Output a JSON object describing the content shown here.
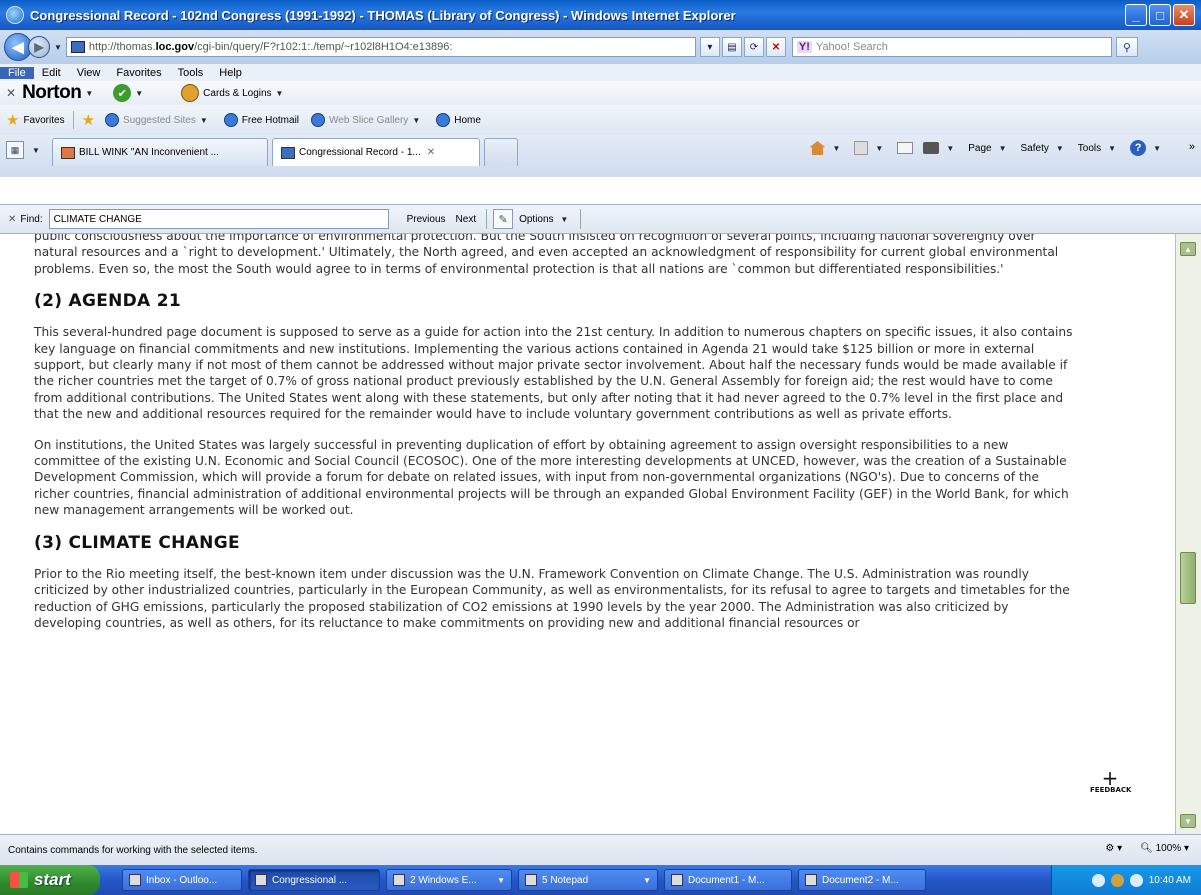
{
  "window": {
    "title": "Congressional Record - 102nd Congress (1991-1992) - THOMAS (Library of Congress) - Windows Internet Explorer"
  },
  "address_bar": {
    "url_prefix": "http://thomas.",
    "url_bold": "loc.gov",
    "url_rest": "/cgi-bin/query/F?r102:1:./temp/~r102l8H1O4:e13896:",
    "search_placeholder": "Yahoo! Search"
  },
  "menu": {
    "items": [
      "File",
      "Edit",
      "View",
      "Favorites",
      "Tools",
      "Help"
    ]
  },
  "norton": {
    "brand": "Norton",
    "cards_label": "Cards & Logins"
  },
  "favorites_bar": {
    "favorites_label": "Favorites",
    "items": [
      "Suggested Sites",
      "Free Hotmail",
      "Web Slice Gallery",
      "Home"
    ]
  },
  "tabs": [
    {
      "label": "BILL WINK \"AN Inconvenient ..."
    },
    {
      "label": "Congressional Record - 1..."
    }
  ],
  "command_bar": {
    "page": "Page",
    "safety": "Safety",
    "tools": "Tools"
  },
  "find_bar": {
    "label": "Find:",
    "value": "CLIMATE CHANGE",
    "previous": "Previous",
    "next": "Next",
    "options": "Options"
  },
  "content": {
    "para0": "public consciousness about the importance of environmental protection. But the South insisted on recognition of several points, including national sovereignty over natural resources and a `right to development.' Ultimately, the North agreed, and even accepted an acknowledgment of responsibility for current global environmental problems. Even so, the most the South would agree to in terms of environmental protection is that all nations are `common but differentiated responsibilities.'",
    "heading1": "(2) AGENDA 21",
    "para1": "This several-hundred page document is supposed to serve as a guide for action into the 21st century. In addition to numerous chapters on specific issues, it also contains key language on financial commitments and new institutions. Implementing the various actions contained in Agenda 21 would take $125 billion or more in external support, but clearly many if not most of them cannot be addressed without major private sector involvement. About half the necessary funds would be made available if the richer countries met the target of 0.7% of gross national product previously established by the U.N. General Assembly for foreign aid; the rest would have to come from additional contributions. The United States went along with these statements, but only after noting that it had never agreed to the 0.7% level in the first place and that the new and additional resources required for the remainder would have to include voluntary government contributions as well as private efforts.",
    "para2": "On institutions, the United States was largely successful in preventing duplication of effort by obtaining agreement to assign oversight responsibilities to a new committee of the existing U.N. Economic and Social Council (ECOSOC). One of the more interesting developments at UNCED, however, was the creation of a Sustainable Development Commission, which will provide a forum for debate on related issues, with input from non-governmental organizations (NGO's). Due to concerns of the richer countries, financial administration of additional environmental projects will be through an expanded Global Environment Facility (GEF) in the World Bank, for which new management arrangements will be worked out.",
    "heading2": "(3) CLIMATE CHANGE",
    "para3": "Prior to the Rio meeting itself, the best-known item under discussion was the U.N. Framework Convention on Climate Change. The U.S. Administration was roundly criticized by other industrialized countries, particularly in the European Community, as well as environmentalists, for its refusal to agree to targets and timetables for the reduction of GHG emissions, particularly the proposed stabilization of CO2 emissions at 1990 levels by the year 2000. The Administration was also criticized by developing countries, as well as others, for its reluctance to make commitments on providing new and additional financial resources or",
    "feedback": "FEEDBACK"
  },
  "status_bar": {
    "text": "Contains commands for working with the selected items.",
    "zoom": "100%"
  },
  "taskbar": {
    "start": "start",
    "items": [
      "Inbox - Outloo...",
      "Congressional ...",
      "2 Windows E...",
      "5 Notepad",
      "Document1 - M...",
      "Document2 - M..."
    ],
    "clock": "10:40 AM"
  }
}
